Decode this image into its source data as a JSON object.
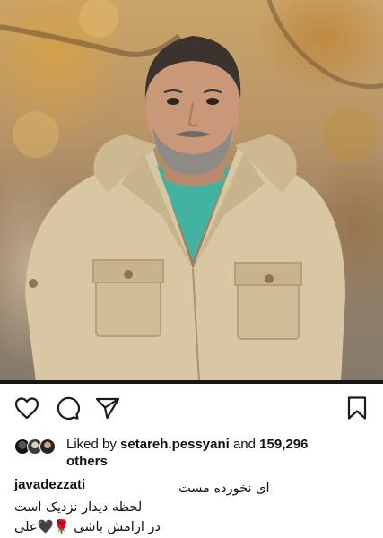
{
  "post": {
    "image_icon": "portrait-photo"
  },
  "actions": {
    "like_icon": "heart-icon",
    "comment_icon": "comment-icon",
    "share_icon": "paper-plane-icon",
    "save_icon": "bookmark-icon"
  },
  "likes": {
    "prefix": "Liked by",
    "user": "setareh.pessyani",
    "and": "and",
    "count": "159,296",
    "others": "others"
  },
  "caption": {
    "username": "javadezzati",
    "lines": [
      "ای نخورده مست",
      "لحظه دیدار نزدیک است",
      "در ارامش باشی 🌹🖤علی"
    ]
  },
  "colors": {
    "icon": "#1a1a1a",
    "text": "#111111",
    "divider": "#161616"
  }
}
